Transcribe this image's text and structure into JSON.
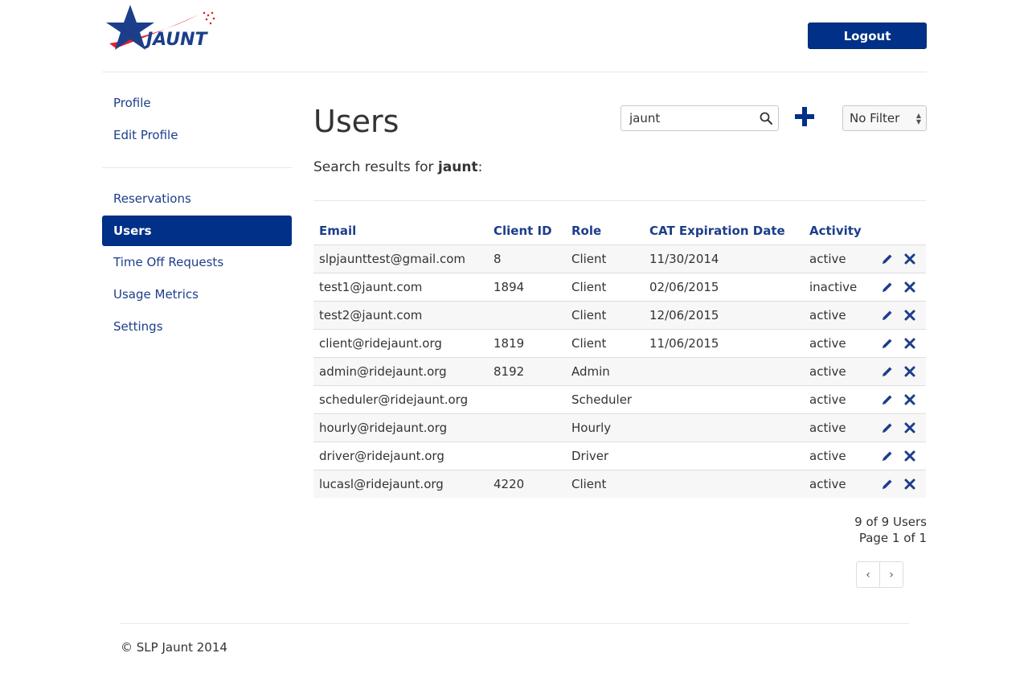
{
  "header": {
    "logo_text": "JAUNT",
    "logout_label": "Logout"
  },
  "sidebar": {
    "items_top": [
      {
        "label": "Profile"
      },
      {
        "label": "Edit Profile"
      }
    ],
    "items_bottom": [
      {
        "label": "Reservations",
        "active": false
      },
      {
        "label": "Users",
        "active": true
      },
      {
        "label": "Time Off Requests",
        "active": false
      },
      {
        "label": "Usage Metrics",
        "active": false
      },
      {
        "label": "Settings",
        "active": false
      }
    ]
  },
  "main": {
    "title": "Users",
    "search": {
      "value": "jaunt",
      "icon": "search-icon"
    },
    "add_icon": "plus-icon",
    "filter": {
      "selected": "No Filter"
    },
    "results_prefix": "Search results for ",
    "results_query": "jaunt",
    "results_suffix": ":",
    "table": {
      "columns": [
        "Email",
        "Client ID",
        "Role",
        "CAT Expiration Date",
        "Activity"
      ],
      "rows": [
        [
          "slpjaunttest@gmail.com",
          "8",
          "Client",
          "11/30/2014",
          "active"
        ],
        [
          "test1@jaunt.com",
          "1894",
          "Client",
          "02/06/2015",
          "inactive"
        ],
        [
          "test2@jaunt.com",
          "",
          "Client",
          "12/06/2015",
          "active"
        ],
        [
          "client@ridejaunt.org",
          "1819",
          "Client",
          "11/06/2015",
          "active"
        ],
        [
          "admin@ridejaunt.org",
          "8192",
          "Admin",
          "",
          "active"
        ],
        [
          "scheduler@ridejaunt.org",
          "",
          "Scheduler",
          "",
          "active"
        ],
        [
          "hourly@ridejaunt.org",
          "",
          "Hourly",
          "",
          "active"
        ],
        [
          "driver@ridejaunt.org",
          "",
          "Driver",
          "",
          "active"
        ],
        [
          "lucasl@ridejaunt.org",
          "4220",
          "Client",
          "",
          "active"
        ]
      ],
      "row_actions": [
        "pencil-icon",
        "close-icon"
      ]
    },
    "count_text": "9 of 9 Users",
    "page_text": "Page 1 of 1",
    "pager": {
      "prev": "‹",
      "next": "›"
    }
  },
  "footer": {
    "text": "© SLP Jaunt 2014"
  },
  "colors": {
    "brand_blue": "#003087",
    "link_blue": "#1c3e8a",
    "logo_red": "#e1222b"
  }
}
